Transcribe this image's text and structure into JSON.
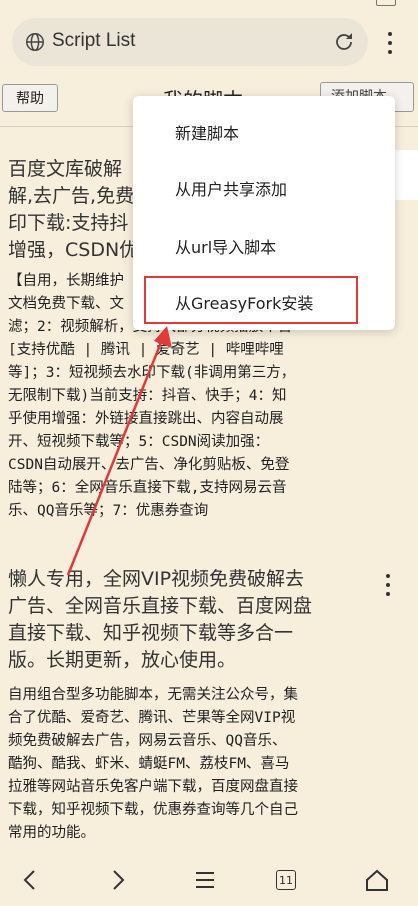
{
  "browser": {
    "url_text": "Script List"
  },
  "toolbar": {
    "help_label": "帮助",
    "title": "我的脚本",
    "add_label": "添加脚本"
  },
  "scripts": [
    {
      "title": "百度文库破解,去广告,免费印下载:支持抖增强，CSDN优",
      "title_lines": [
        "百度文库破解",
        "解,去广告,免费",
        "印下载:支持抖",
        "增强，CSDN优"
      ],
      "desc_lines": [
        "【自用，长期维护",
        "文档免费下载、文",
        "滤；2：视频解析，支持大部分视频播放平台",
        "[支持优酷 | 腾讯 | 爱奇艺 | 哔哩哔哩",
        "等]；3：短视频去水印下载(非调用第三方，",
        "无限制下载)当前支持：抖音、快手；4：知",
        "乎使用增强：外链接直接跳出、内容自动展",
        "开、短视频下载等；5：CSDN阅读加强：",
        "CSDN自动展开、去广告、净化剪贴板、免登",
        "陆等；6：全网音乐直接下载,支持网易云音",
        "乐、QQ音乐等；7：优惠券查询"
      ]
    },
    {
      "title_lines": [
        "懒人专用，全网VIP视频免费破解去",
        "广告、全网音乐直接下载、百度网盘",
        "直接下载、知乎视频下载等多合一",
        "版。长期更新，放心使用。"
      ],
      "desc_lines": [
        "自用组合型多功能脚本，无需关注公众号，集",
        "合了优酷、爱奇艺、腾讯、芒果等全网VIP视",
        "频免费破解去广告，网易云音乐、QQ音乐、",
        "酷狗、酷我、虾米、蜻蜓FM、荔枝FM、喜马",
        "拉雅等网站音乐免客户端下载，百度网盘直接",
        "下载，知乎视频下载，优惠券查询等几个自己",
        "常用的功能。"
      ]
    }
  ],
  "menu": {
    "items": [
      {
        "label": "新建脚本"
      },
      {
        "label": "从用户共享添加"
      },
      {
        "label": "从url导入脚本"
      },
      {
        "label": "从GreasyFork安装"
      }
    ]
  },
  "nav": {
    "tabs_count": "11"
  },
  "colors": {
    "background": "#f7efdc",
    "highlight": "#e03a3a",
    "arrow": "#e03a3a"
  }
}
